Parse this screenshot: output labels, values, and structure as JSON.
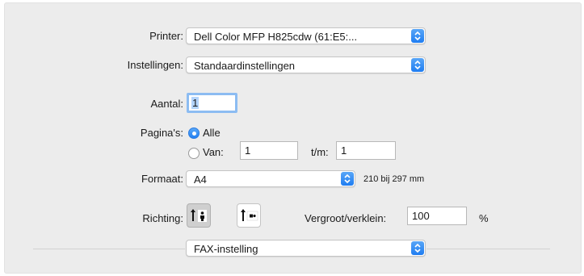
{
  "printer": {
    "label": "Printer:",
    "value": "Dell Color MFP H825cdw (61:E5:..."
  },
  "presets": {
    "label": "Instellingen:",
    "value": "Standaardinstellingen"
  },
  "copies": {
    "label": "Aantal:",
    "value": "1"
  },
  "pages": {
    "label": "Pagina's:",
    "all_label": "Alle",
    "from_label": "Van:",
    "from_value": "1",
    "to_label": "t/m:",
    "to_value": "1",
    "selected": "all"
  },
  "paper_size": {
    "label": "Formaat:",
    "value": "A4",
    "dimensions": "210 bij 297 mm"
  },
  "orientation": {
    "label": "Richting:",
    "selected": "portrait",
    "options": [
      "portrait-icon",
      "landscape-icon"
    ]
  },
  "scale": {
    "label": "Vergroot/verklein:",
    "value": "100",
    "unit": "%"
  },
  "section": {
    "value": "FAX-instelling"
  },
  "colors": {
    "accent": "#2280f2",
    "panel": "#ececec"
  }
}
